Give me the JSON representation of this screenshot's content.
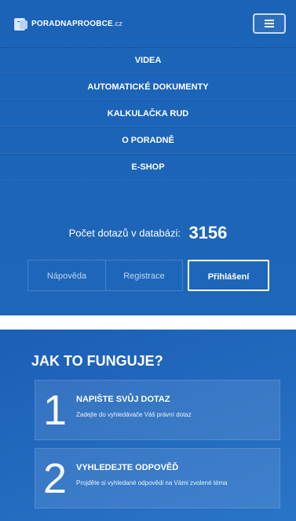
{
  "header": {
    "logo_text": "PORADNAPROOBCE",
    "logo_suffix": ".cz",
    "menu_icon": "hamburger-icon"
  },
  "nav": {
    "items": [
      {
        "label": "VIDEA"
      },
      {
        "label": "AUTOMATICKÉ DOKUMENTY"
      },
      {
        "label": "KALKULAČKA RUD"
      },
      {
        "label": "O PORADNĚ"
      },
      {
        "label": "E-SHOP"
      }
    ]
  },
  "stats": {
    "label": "Počet dotazů v databázi:",
    "count": "3156"
  },
  "buttons": {
    "help": "Nápověda",
    "register": "Registrace",
    "login": "Přihlášení"
  },
  "how": {
    "title": "JAK TO FUNGUJE?",
    "steps": [
      {
        "number": "1",
        "title": "NAPIŠTE SVŮJ DOTAZ",
        "desc": "Zadejte do vyhledávače Váš právní dotaz"
      },
      {
        "number": "2",
        "title": "VYHLEDEJTE ODPOVĚĎ",
        "desc": "Projděte si vyhledané odpovědi na Vámi zvolené téma"
      }
    ]
  },
  "colors": {
    "primary": "#1a63b7",
    "bottom": "#2a74c7"
  }
}
